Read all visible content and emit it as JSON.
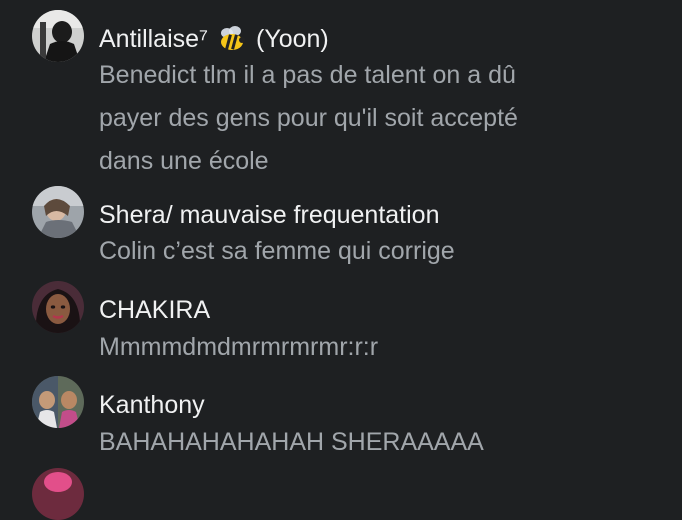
{
  "comments": [
    {
      "user": "Antillaise⁷",
      "user_suffix": "(Yoon)",
      "emoji_icon": "bee-icon",
      "text": "Benedict tlm il a pas de talent on a dû\npayer des gens pour qu'il soit accepté\ndans une école"
    },
    {
      "user": "Shera/ mauvaise frequentation",
      "text": "Colin c’est sa femme qui corrige"
    },
    {
      "user": "CHAKIRA",
      "text": "Mmmmdmdmrmrmrmr:r:r"
    },
    {
      "user": "Kanthony",
      "text": "BAHAHAHAHAHAH SHERAAAAA"
    }
  ],
  "colors": {
    "background": "#1e2022",
    "username": "#f0f1f2",
    "comment_text": "#a1a6ab"
  }
}
